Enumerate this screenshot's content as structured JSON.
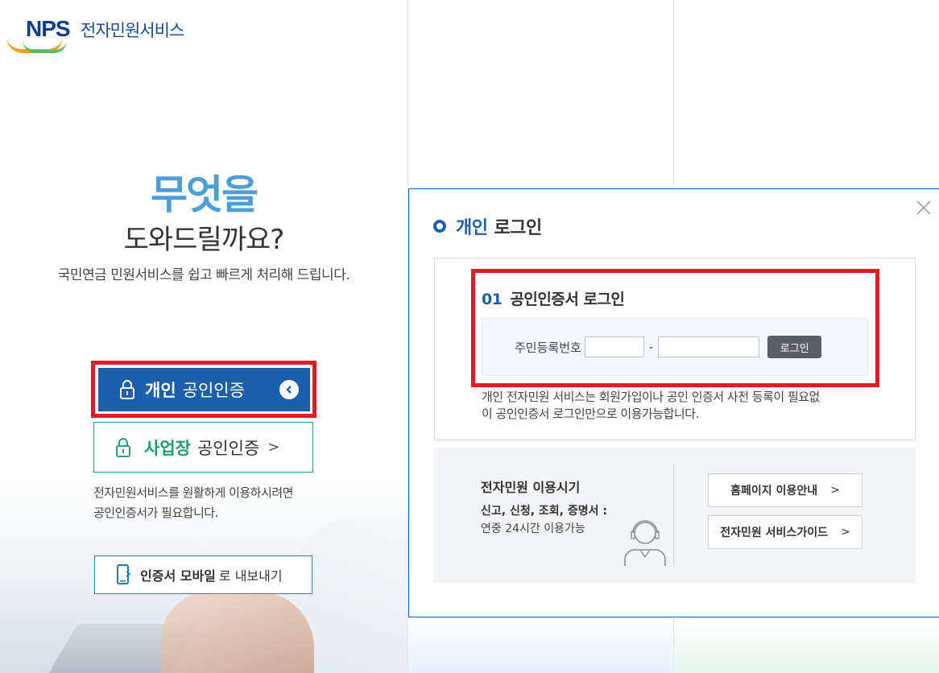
{
  "logo": {
    "brand": "NPS",
    "service_name": "전자민원서비스"
  },
  "hero": {
    "title": "무엇을",
    "subtitle": "도와드릴까요?",
    "description": "국민연금 민원서비스를 쉽고 빠르게 처리해 드립니다."
  },
  "left_buttons": {
    "personal_strong": "개인",
    "personal_light": "공인인증",
    "business_strong": "사업장",
    "business_light": "공인인증",
    "business_arrow": ">",
    "notice_line1": "전자민원서비스를 원활하게 이용하시려면",
    "notice_line2": "공인인증서가 필요합니다.",
    "mobile_strong": "인증서 모바일",
    "mobile_light": "로 내보내기"
  },
  "panel": {
    "title_blue": "개인",
    "title_rest": "로그인",
    "cert_number": "01",
    "cert_title": "공인인증서 로그인",
    "ssn_label": "주민등록번호",
    "ssn_dash": "-",
    "ssn_first_value": "",
    "ssn_second_value": "",
    "login_button": "로그인",
    "note_line1": "개인 전자민원 서비스는 회원가입이나 공인 인증서 사전 등록이 필요없",
    "note_line2": "이 공인인증서 로그인만으로 이용가능합니다."
  },
  "info": {
    "title": "전자민원 이용시기",
    "sub_bold": "신고, 신청, 조회, 증명서 :",
    "sub_text": "연중 24시간 이용가능",
    "btn_homepage": "홈페이지 이용안내",
    "btn_guide": "전자민원 서비스가이드",
    "btn_arrow": ">"
  },
  "colors": {
    "primary_blue": "#1b5fad",
    "highlight_red": "#e11b22",
    "business_green": "#1f9c74",
    "hero_blue": "#4b9fd6"
  },
  "icons": [
    "lock-icon",
    "chevron-left-icon",
    "phone-icon",
    "close-icon",
    "agent-icon"
  ]
}
